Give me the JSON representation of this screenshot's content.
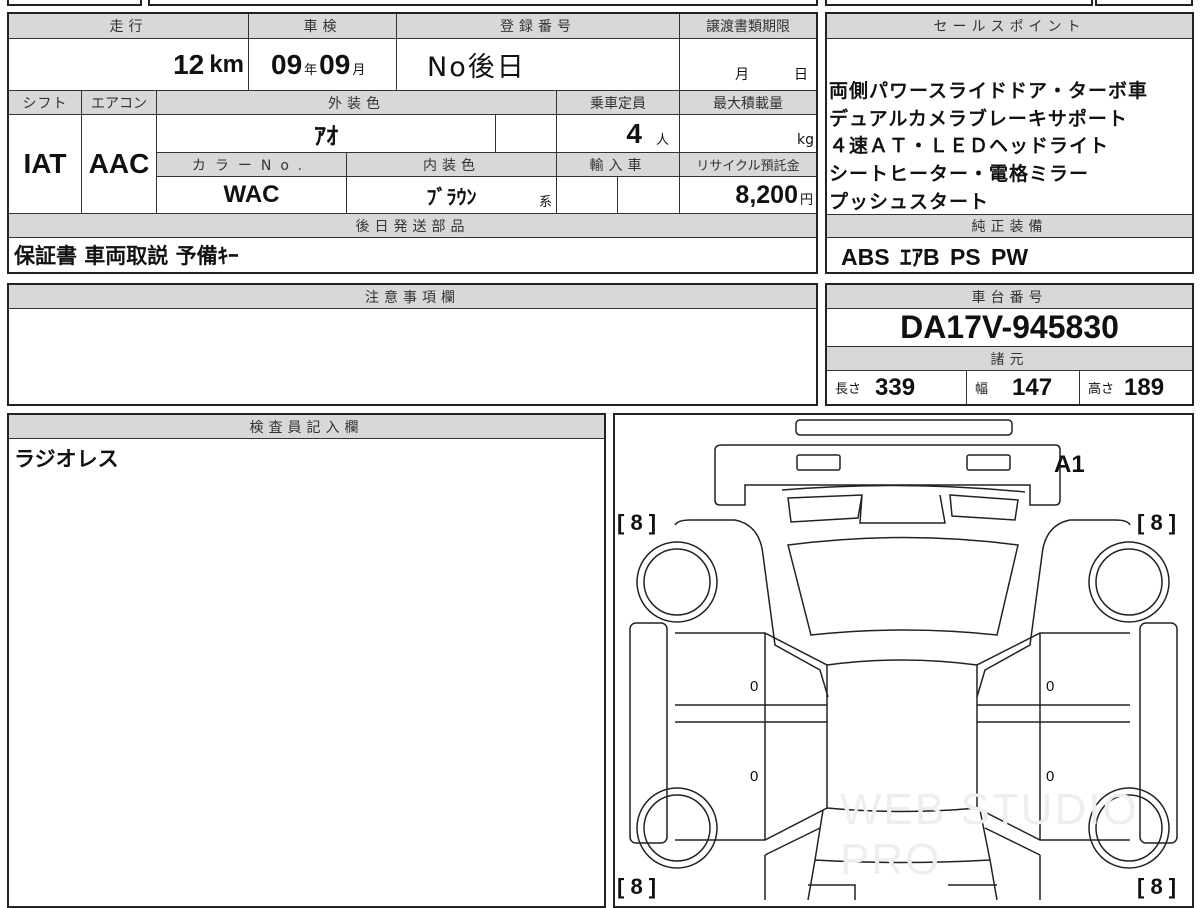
{
  "headers": {
    "mileage": "走行",
    "inspection": "車検",
    "registration": "登録番号",
    "transfer_deadline": "譲渡書類期限",
    "shift": "シフト",
    "aircon": "エアコン",
    "exterior_color": "外装色",
    "capacity": "乗車定員",
    "max_load": "最大積載量",
    "color_no": "カラーNo.",
    "interior_color": "内装色",
    "import": "輸入車",
    "recycle_fee": "リサイクル預託金",
    "later_parts": "後日発送部品",
    "sales_points": "セールスポイント",
    "standard_equipment": "純正装備",
    "notes": "注意事項欄",
    "chassis_number": "車台番号",
    "specs": "諸元",
    "inspector": "検査員記入欄"
  },
  "values": {
    "mileage": "12",
    "mileage_unit": "km",
    "inspection_year": "09",
    "year_unit": "年",
    "inspection_month": "09",
    "month_unit": "月",
    "registration": "No後日",
    "deadline_month_unit": "月",
    "deadline_day_unit": "日",
    "shift": "IAT",
    "aircon": "AAC",
    "exterior_color": "ｱｵ",
    "capacity": "4",
    "capacity_unit": "人",
    "max_load_unit": "kg",
    "color_no": "WAC",
    "interior_color": "ﾌﾞﾗｳﾝ",
    "interior_suffix": "系",
    "recycle_fee": "8,200",
    "yen_unit": "円",
    "later_parts": "保証書 車両取説 予備ｷｰ",
    "standard_equipment": "ABS ｴｱB PS PW",
    "chassis_number": "DA17V-945830",
    "length_label": "長さ",
    "length": "339",
    "width_label": "幅",
    "width": "147",
    "height_label": "高さ",
    "height": "189",
    "inspector_note": "ラジオレス"
  },
  "sales_points": [
    "両側パワースライドドア・ターボ車",
    "デュアルカメラブレーキサポート",
    "４速ＡＴ・ＬＥＤヘッドライト",
    "シートヒーター・電格ミラー",
    "プッシュスタート"
  ],
  "diagram": {
    "tire_fl": "[ 8 ]",
    "tire_fr": "[ 8 ]",
    "tire_rl": "[ 8 ]",
    "tire_rr": "[ 8 ]",
    "front_mark": "A1",
    "door_marks": [
      "0",
      "0",
      "0",
      "0"
    ]
  },
  "watermark": "WEB STUDIO PRO"
}
